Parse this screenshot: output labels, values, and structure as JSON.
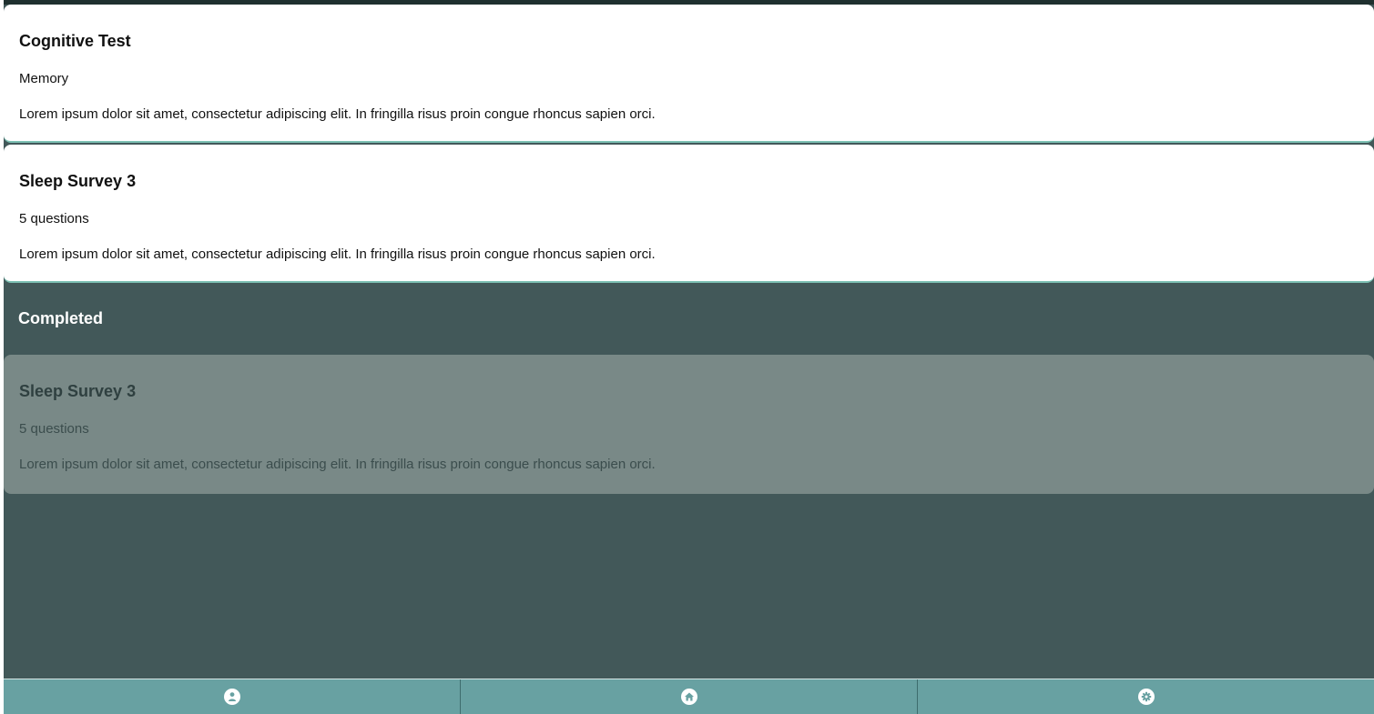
{
  "surveys": {
    "pending": [
      {
        "title": "Cognitive Test",
        "subtitle": "Memory",
        "description": "Lorem ipsum dolor sit amet, consectetur adipiscing elit. In fringilla risus proin congue rhoncus sapien orci."
      },
      {
        "title": "Sleep Survey 3",
        "subtitle": "5 questions",
        "description": "Lorem ipsum dolor sit amet, consectetur adipiscing elit. In fringilla risus proin congue rhoncus sapien orci."
      }
    ],
    "completed_heading": "Completed",
    "completed": [
      {
        "title": "Sleep Survey 3",
        "subtitle": "5 questions",
        "description": "Lorem ipsum dolor sit amet, consectetur adipiscing elit. In fringilla risus proin congue rhoncus sapien orci."
      }
    ]
  },
  "tabbar": {
    "tabs": [
      {
        "icon": "user-icon"
      },
      {
        "icon": "home-icon"
      },
      {
        "icon": "gear-icon"
      }
    ]
  },
  "colors": {
    "background": "#425859",
    "card": "#ffffff",
    "completed_card": "#798987",
    "tabbar": "#68a1a2",
    "accent": "#7dc1b4"
  }
}
